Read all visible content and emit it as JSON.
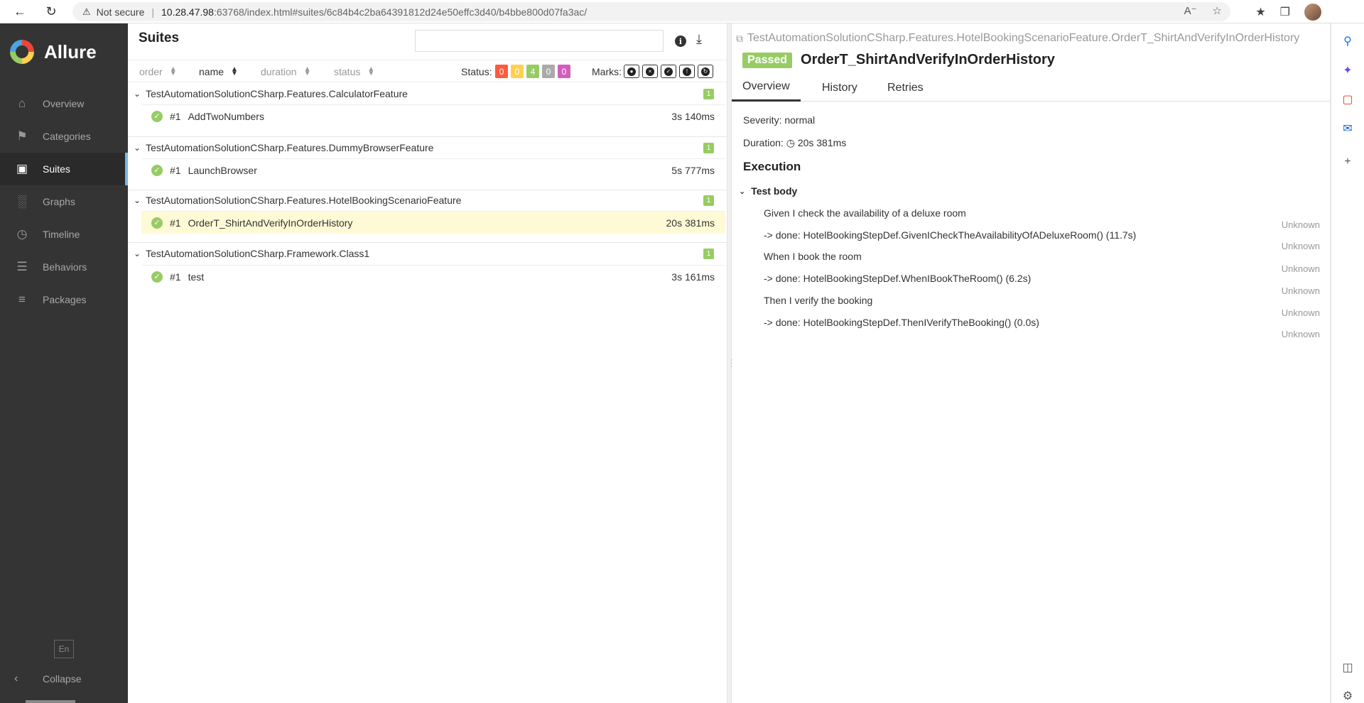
{
  "browser": {
    "warning_icon": "warning-icon",
    "not_secure": "Not secure",
    "url_host": "10.28.47.98",
    "url_rest": ":63768/index.html#suites/6c84b4c2ba64391812d24e50effc3d40/b4bbe800d07fa3ac/"
  },
  "sidebar": {
    "logo": "Allure",
    "items": [
      {
        "label": "Overview",
        "icon": "home-icon"
      },
      {
        "label": "Categories",
        "icon": "flag-icon"
      },
      {
        "label": "Suites",
        "icon": "briefcase-icon"
      },
      {
        "label": "Graphs",
        "icon": "bar-chart-icon"
      },
      {
        "label": "Timeline",
        "icon": "clock-icon"
      },
      {
        "label": "Behaviors",
        "icon": "list-icon"
      },
      {
        "label": "Packages",
        "icon": "align-left-icon"
      }
    ],
    "lang": "En",
    "collapse": "Collapse"
  },
  "suites": {
    "title": "Suites",
    "sort": {
      "order": "order",
      "name": "name",
      "duration": "duration",
      "status": "status"
    },
    "status_label": "Status:",
    "status_counts": [
      {
        "value": "0",
        "color": "#fd5a3e"
      },
      {
        "value": "0",
        "color": "#ffd050"
      },
      {
        "value": "4",
        "color": "#97cc64"
      },
      {
        "value": "0",
        "color": "#aaaaaa"
      },
      {
        "value": "0",
        "color": "#d35ebe"
      }
    ],
    "marks_label": "Marks:",
    "groups": [
      {
        "name": "TestAutomationSolutionCSharp.Features.CalculatorFeature",
        "count": "1",
        "rows": [
          {
            "num": "#1",
            "name": "AddTwoNumbers",
            "duration": "3s 140ms"
          }
        ]
      },
      {
        "name": "TestAutomationSolutionCSharp.Features.DummyBrowserFeature",
        "count": "1",
        "rows": [
          {
            "num": "#1",
            "name": "LaunchBrowser",
            "duration": "5s 777ms"
          }
        ]
      },
      {
        "name": "TestAutomationSolutionCSharp.Features.HotelBookingScenarioFeature",
        "count": "1",
        "rows": [
          {
            "num": "#1",
            "name": "OrderT_ShirtAndVerifyInOrderHistory",
            "duration": "20s 381ms"
          }
        ]
      },
      {
        "name": "TestAutomationSolutionCSharp.Framework.Class1",
        "count": "1",
        "rows": [
          {
            "num": "#1",
            "name": "test",
            "duration": "3s 161ms"
          }
        ]
      }
    ]
  },
  "details": {
    "path": "TestAutomationSolutionCSharp.Features.HotelBookingScenarioFeature.OrderT_ShirtAndVerifyInOrderHistory",
    "status": "Passed",
    "name": "OrderT_ShirtAndVerifyInOrderHistory",
    "tabs": [
      "Overview",
      "History",
      "Retries"
    ],
    "severity": "Severity: normal",
    "duration_label": "Duration:",
    "duration": "20s 381ms",
    "execution": "Execution",
    "test_body": "Test body",
    "steps": [
      "Given I check the availability of a deluxe room",
      "-> done: HotelBookingStepDef.GivenICheckTheAvailabilityOfADeluxeRoom() (11.7s)",
      "When I book the room",
      "-> done: HotelBookingStepDef.WhenIBookTheRoom() (6.2s)",
      "Then I verify the booking",
      "-> done: HotelBookingStepDef.ThenIVerifyTheBooking() (0.0s)"
    ],
    "unknown_label": "Unknown"
  }
}
